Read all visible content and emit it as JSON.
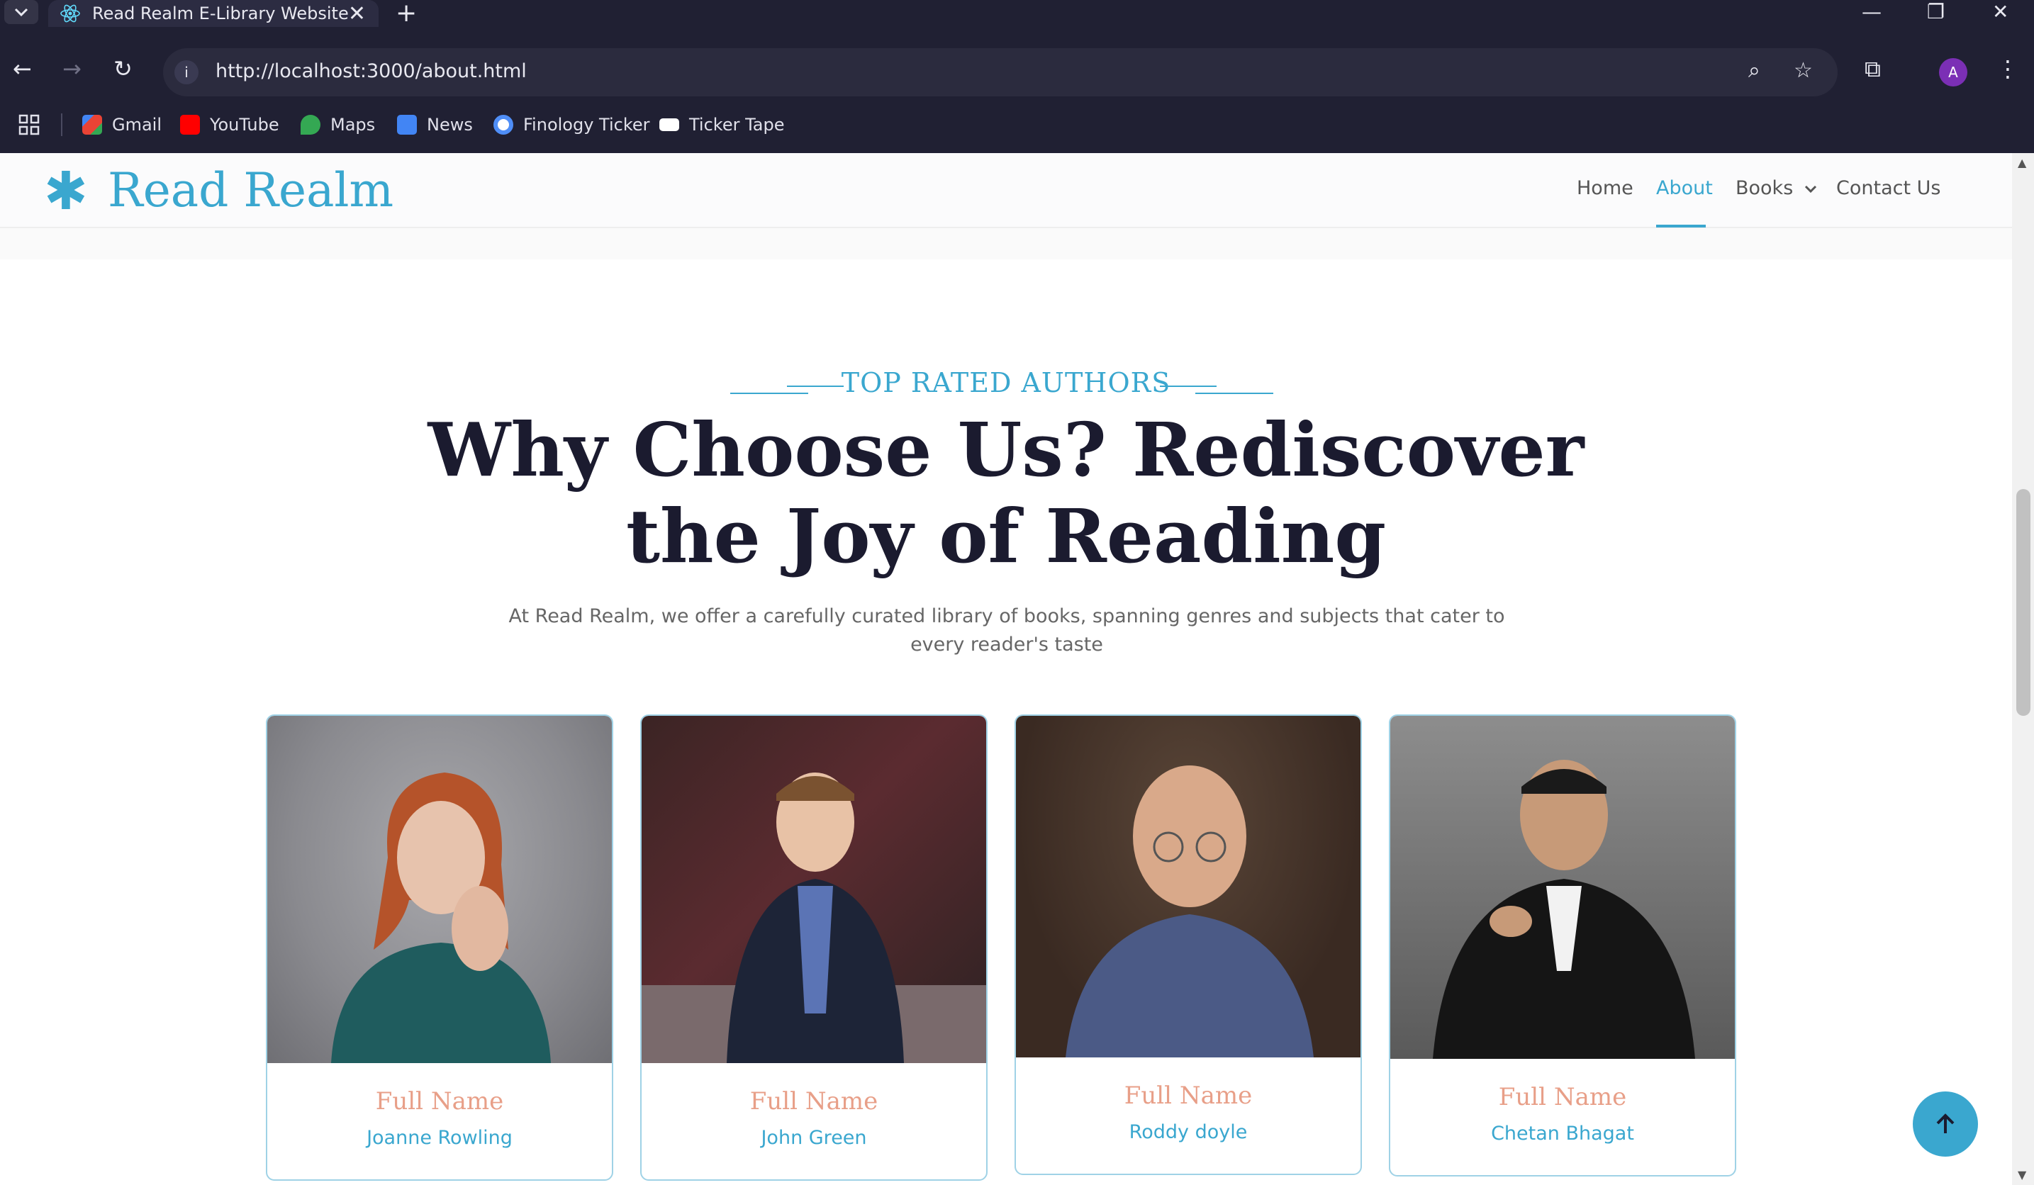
{
  "browser": {
    "tab_title": "Read Realm E-Library Website",
    "tab_close": "✕",
    "new_tab": "+",
    "url": "http://localhost:3000/about.html",
    "avatar_letter": "A",
    "bookmarks": [
      {
        "label": "Gmail",
        "icon": "gmail-icon",
        "color": "#ea4335"
      },
      {
        "label": "YouTube",
        "icon": "youtube-icon",
        "color": "#ff0000"
      },
      {
        "label": "Maps",
        "icon": "maps-icon",
        "color": "#34a853"
      },
      {
        "label": "News",
        "icon": "news-icon",
        "color": "#4285f4"
      },
      {
        "label": "Finology Ticker",
        "icon": "finology-icon",
        "color": "#4f8ef7"
      },
      {
        "label": "Ticker Tape",
        "icon": "tickertape-icon",
        "color": "#ffffff"
      }
    ]
  },
  "site": {
    "logo_mark": "✱",
    "logo_text": "Read Realm",
    "accent_color": "#3aa7cf",
    "nav": {
      "home": "Home",
      "about": "About",
      "books": "Books",
      "contact": "Contact Us"
    }
  },
  "section": {
    "kicker": "TOP RATED AUTHORS",
    "title_line1": "Why Choose Us? Rediscover",
    "title_line2": "the Joy of Reading",
    "description": "At Read Realm, we offer a carefully curated library of books, spanning genres and subjects that cater to every reader's taste"
  },
  "authors": [
    {
      "role": "Full Name",
      "name": "Joanne Rowling"
    },
    {
      "role": "Full Name",
      "name": "John Green"
    },
    {
      "role": "Full Name",
      "name": "Roddy doyle"
    },
    {
      "role": "Full Name",
      "name": "Chetan Bhagat"
    }
  ]
}
